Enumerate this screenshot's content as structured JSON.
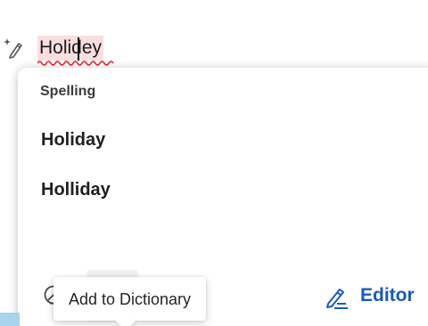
{
  "document": {
    "misspelled_word": "Holidey"
  },
  "popup": {
    "section_heading": "Spelling",
    "suggestions": [
      {
        "label": "Holiday"
      },
      {
        "label": "Holliday"
      }
    ],
    "toolbar": {
      "ignore_icon": "ignore-circle-icon",
      "add_icon": "add-to-dictionary-icon",
      "more_label": "···",
      "editor_icon": "editor-pen-icon",
      "editor_label": "Editor"
    },
    "tooltip": {
      "text": "Add to Dictionary"
    }
  },
  "colors": {
    "accent": "#185abd",
    "misspell_highlight": "#fadede",
    "squiggle": "#e0242c"
  }
}
